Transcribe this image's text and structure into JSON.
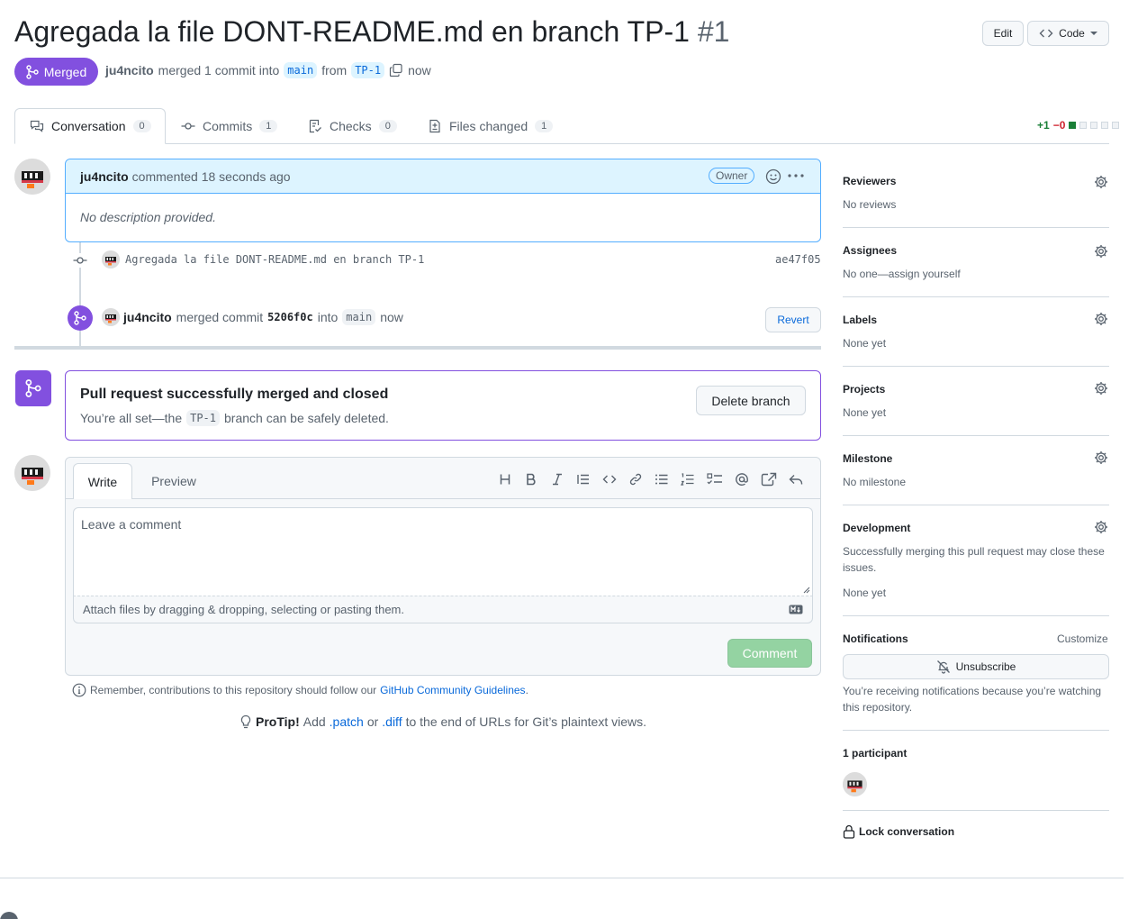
{
  "header": {
    "title": "Agregada la file DONT-README.md en branch TP-1",
    "number": "#1",
    "edit_label": "Edit",
    "code_label": "Code",
    "state_label": "Merged",
    "author": "ju4ncito",
    "merged_text": "merged 1 commit into",
    "base_branch": "main",
    "from_text": "from",
    "head_branch": "TP-1",
    "time": "now"
  },
  "tabs": [
    {
      "label": "Conversation",
      "count": "0"
    },
    {
      "label": "Commits",
      "count": "1"
    },
    {
      "label": "Checks",
      "count": "0"
    },
    {
      "label": "Files changed",
      "count": "1"
    }
  ],
  "diffstat": {
    "additions": "+1",
    "deletions": "−0"
  },
  "comment": {
    "author": "ju4ncito",
    "meta": "commented 18 seconds ago",
    "role": "Owner",
    "body": "No description provided."
  },
  "commit": {
    "message": "Agregada la file DONT-README.md en branch TP-1",
    "sha": "ae47f05"
  },
  "merge_event": {
    "author": "ju4ncito",
    "text1": "merged commit",
    "sha": "5206f0c",
    "text2": "into",
    "branch": "main",
    "time": "now",
    "revert_label": "Revert"
  },
  "merged_box": {
    "title": "Pull request successfully merged and closed",
    "text_before": "You’re all set—the",
    "branch": "TP-1",
    "text_after": "branch can be safely deleted.",
    "delete_label": "Delete branch"
  },
  "editor": {
    "write_tab": "Write",
    "preview_tab": "Preview",
    "placeholder": "Leave a comment",
    "attach_text": "Attach files by dragging & dropping, selecting or pasting them.",
    "submit_label": "Comment"
  },
  "guidelines": {
    "text": "Remember, contributions to this repository should follow our",
    "link": "GitHub Community Guidelines",
    "end": "."
  },
  "protip": {
    "bold": "ProTip!",
    "t1": "Add",
    "patch": ".patch",
    "t2": "or",
    "diff": ".diff",
    "t3": "to the end of URLs for Git’s plaintext views."
  },
  "sidebar": {
    "reviewers": {
      "title": "Reviewers",
      "value": "No reviews"
    },
    "assignees": {
      "title": "Assignees",
      "value": "No one—assign yourself"
    },
    "labels": {
      "title": "Labels",
      "value": "None yet"
    },
    "projects": {
      "title": "Projects",
      "value": "None yet"
    },
    "milestone": {
      "title": "Milestone",
      "value": "No milestone"
    },
    "development": {
      "title": "Development",
      "desc": "Successfully merging this pull request may close these issues.",
      "value": "None yet"
    },
    "notifications": {
      "title": "Notifications",
      "customize": "Customize",
      "unsubscribe": "Unsubscribe",
      "desc": "You’re receiving notifications because you’re watching this repository."
    },
    "participants": {
      "title": "1 participant"
    },
    "lock": "Lock conversation"
  },
  "colors": {
    "merged": "#8250df",
    "accent": "#0969da",
    "comment_btn": "#94d3a2"
  }
}
